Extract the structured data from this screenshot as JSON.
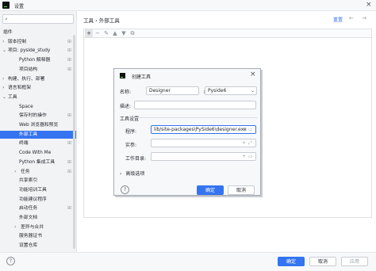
{
  "window": {
    "title": "设置"
  },
  "sidebar": {
    "items": [
      {
        "label": "插件",
        "arrow": "",
        "indent": 0,
        "gear": false,
        "selected": false
      },
      {
        "label": "版本控制",
        "arrow": "›",
        "indent": 0,
        "gear": true,
        "selected": false
      },
      {
        "label": "项目: pyside_study",
        "arrow": "⌄",
        "indent": 0,
        "gear": true,
        "selected": false
      },
      {
        "label": "Python 解释器",
        "arrow": "",
        "indent": 1,
        "gear": true,
        "selected": false
      },
      {
        "label": "项目结构",
        "arrow": "",
        "indent": 1,
        "gear": true,
        "selected": false
      },
      {
        "label": "构建、执行、部署",
        "arrow": "›",
        "indent": 0,
        "gear": false,
        "selected": false
      },
      {
        "label": "语言和框架",
        "arrow": "›",
        "indent": 0,
        "gear": false,
        "selected": false
      },
      {
        "label": "工具",
        "arrow": "⌄",
        "indent": 0,
        "gear": false,
        "selected": false
      },
      {
        "label": "Space",
        "arrow": "",
        "indent": 1,
        "gear": false,
        "selected": false
      },
      {
        "label": "保存时的操作",
        "arrow": "",
        "indent": 1,
        "gear": true,
        "selected": false
      },
      {
        "label": "Web 浏览器和预览",
        "arrow": "",
        "indent": 1,
        "gear": false,
        "selected": false
      },
      {
        "label": "外部工具",
        "arrow": "",
        "indent": 1,
        "gear": false,
        "selected": true
      },
      {
        "label": "终端",
        "arrow": "",
        "indent": 1,
        "gear": true,
        "selected": false
      },
      {
        "label": "Code With Me",
        "arrow": "",
        "indent": 1,
        "gear": false,
        "selected": false
      },
      {
        "label": "Python 集成工具",
        "arrow": "",
        "indent": 1,
        "gear": true,
        "selected": false
      },
      {
        "label": "任务",
        "arrow": "›",
        "indent": 1,
        "gear": true,
        "selected": false
      },
      {
        "label": "共享索引",
        "arrow": "",
        "indent": 1,
        "gear": false,
        "selected": false
      },
      {
        "label": "功能培训工具",
        "arrow": "",
        "indent": 1,
        "gear": false,
        "selected": false
      },
      {
        "label": "功能建议程序",
        "arrow": "",
        "indent": 1,
        "gear": false,
        "selected": false
      },
      {
        "label": "启动任务",
        "arrow": "",
        "indent": 1,
        "gear": true,
        "selected": false
      },
      {
        "label": "外部文档",
        "arrow": "",
        "indent": 1,
        "gear": false,
        "selected": false
      },
      {
        "label": "差异与合并",
        "arrow": "›",
        "indent": 1,
        "gear": false,
        "selected": false
      },
      {
        "label": "服务器证书",
        "arrow": "",
        "indent": 1,
        "gear": false,
        "selected": false
      },
      {
        "label": "设置仓库",
        "arrow": "",
        "indent": 1,
        "gear": false,
        "selected": false
      }
    ]
  },
  "main": {
    "breadcrumb": "工具 › 外部工具",
    "reset_label": "重置",
    "nav_arrows": "← →",
    "toolbar": {
      "add": "+",
      "remove": "−",
      "edit": "✎",
      "up": "▲",
      "down": "▼",
      "copy": "⧉"
    }
  },
  "dialog": {
    "title": "创建工具",
    "name_label": "名称:",
    "name_value": "Designer",
    "group_label": "组:",
    "group_value": "Pyside6",
    "description_label": "描述:",
    "description_value": "",
    "section_title": "工具设置",
    "program_label": "程序:",
    "program_value": "lib/site-packages\\PySide6\\designer.exe",
    "args_label": "实参:",
    "args_value": "",
    "workdir_label": "工作目录:",
    "workdir_value": "",
    "advanced_label": "高级选项",
    "help": "?",
    "ok_label": "确定",
    "cancel_label": "取消"
  },
  "footer": {
    "help": "?",
    "ok_label": "确定",
    "cancel_label": "取消",
    "apply_label": "应用"
  }
}
